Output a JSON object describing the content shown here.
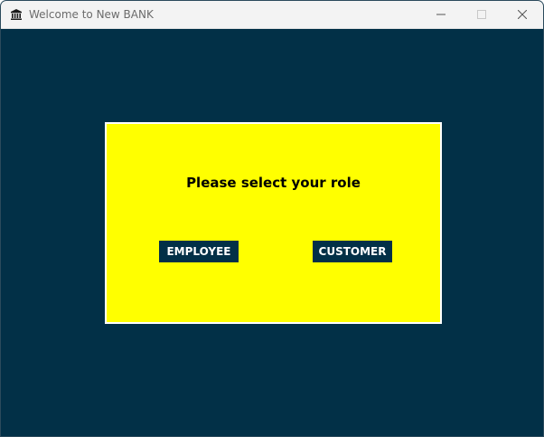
{
  "window": {
    "title": "Welcome to New BANK",
    "icon": "bank-icon",
    "controls": {
      "minimize_icon": "minimize-icon",
      "maximize_icon": "maximize-icon",
      "close_icon": "close-icon"
    }
  },
  "main": {
    "prompt": "Please select your role",
    "buttons": {
      "employee_label": "EMPLOYEE",
      "customer_label": "CUSTOMER"
    }
  },
  "colors": {
    "background": "#023047",
    "panel": "#ffff00",
    "panel_border": "#ffffff",
    "button_bg": "#023047",
    "button_text": "#ffffff",
    "prompt_text": "#000000"
  }
}
